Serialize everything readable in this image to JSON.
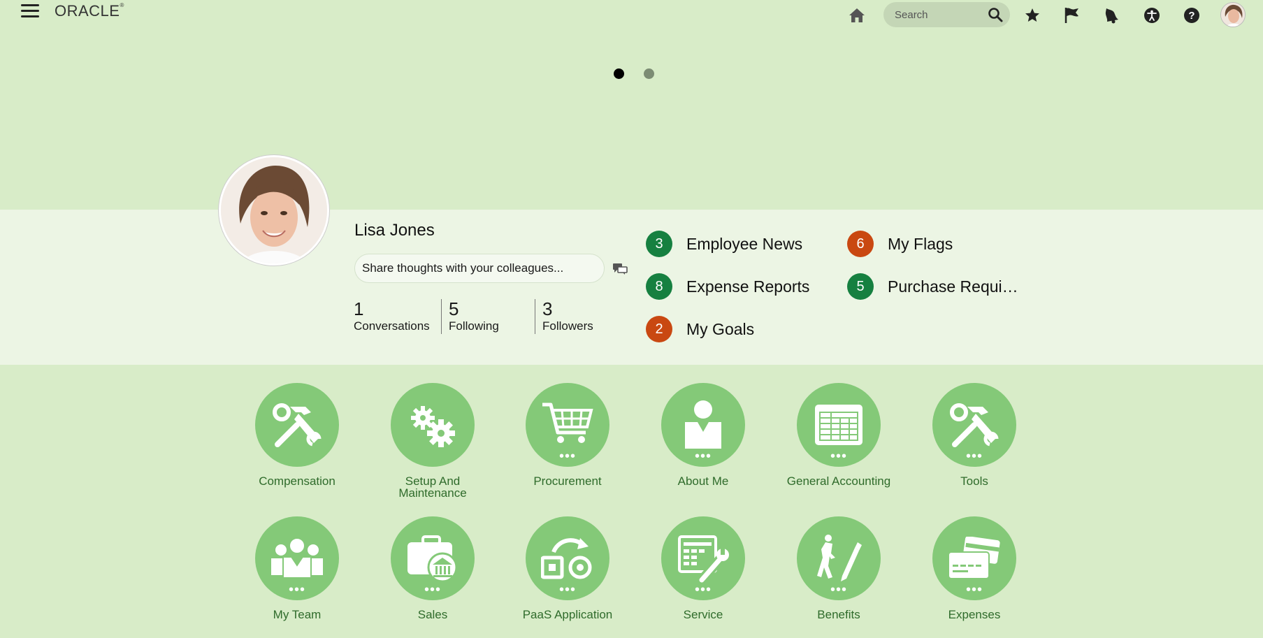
{
  "header": {
    "logo": "ORACLE",
    "logo_reg": "®",
    "search_placeholder": "Search",
    "icons": [
      "hamburger-icon",
      "home-icon",
      "search-icon",
      "favorites-star-icon",
      "flag-icon",
      "notifications-bell-icon",
      "accessibility-icon",
      "help-icon",
      "user-avatar"
    ]
  },
  "carousel": {
    "dot_count": 2,
    "active_index": 0
  },
  "profile": {
    "name": "Lisa Jones",
    "share_placeholder": "Share thoughts with your colleagues...",
    "stats": [
      {
        "value": "1",
        "label": "Conversations"
      },
      {
        "value": "5",
        "label": "Following"
      },
      {
        "value": "3",
        "label": "Followers"
      }
    ]
  },
  "counters": [
    {
      "count": "3",
      "label": "Employee News",
      "color": "#168040"
    },
    {
      "count": "6",
      "label": "My Flags",
      "color": "#c94811"
    },
    {
      "count": "8",
      "label": "Expense Reports",
      "color": "#168040"
    },
    {
      "count": "5",
      "label": "Purchase Requi…",
      "color": "#168040"
    },
    {
      "count": "2",
      "label": "My Goals",
      "color": "#c94811"
    }
  ],
  "apps": [
    {
      "label": "Compensation",
      "icon": "tools-icon",
      "more": false
    },
    {
      "label": "Setup And Maintenance",
      "icon": "gears-icon",
      "more": false
    },
    {
      "label": "Procurement",
      "icon": "cart-icon",
      "more": true
    },
    {
      "label": "About Me",
      "icon": "person-icon",
      "more": true
    },
    {
      "label": "General Accounting",
      "icon": "ledger-icon",
      "more": true
    },
    {
      "label": "Tools",
      "icon": "tools-icon",
      "more": true
    },
    {
      "label": "My Team",
      "icon": "team-icon",
      "more": true
    },
    {
      "label": "Sales",
      "icon": "briefcase-bank-icon",
      "more": true
    },
    {
      "label": "PaaS Application",
      "icon": "paas-icon",
      "more": true
    },
    {
      "label": "Service",
      "icon": "service-icon",
      "more": true
    },
    {
      "label": "Benefits",
      "icon": "benefits-icon",
      "more": true
    },
    {
      "label": "Expenses",
      "icon": "cards-icon",
      "more": true
    }
  ],
  "colors": {
    "background": "#d8ecc8",
    "band": "#ecf5e4",
    "app_circle": "#84c978",
    "app_label": "#2f6b2b",
    "badge_green": "#168040",
    "badge_orange": "#c94811"
  }
}
